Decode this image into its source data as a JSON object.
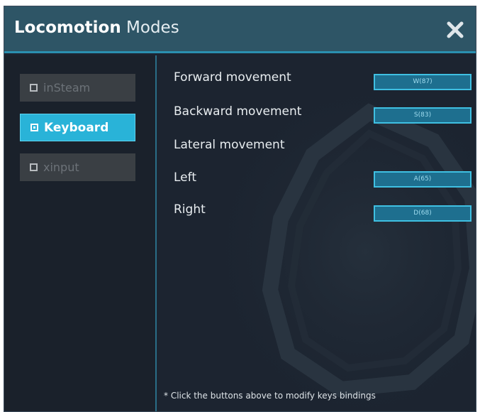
{
  "window": {
    "title_bold": "Locomotion",
    "title_light": "Modes",
    "close_icon": "close-icon"
  },
  "sidebar": {
    "modes": [
      {
        "label": "inSteam",
        "active": false
      },
      {
        "label": "Keyboard",
        "active": true
      },
      {
        "label": "xinput",
        "active": false
      }
    ]
  },
  "bindings": {
    "forward": {
      "label": "Forward movement",
      "key": "W(87)"
    },
    "backward": {
      "label": "Backward movement",
      "key": "S(83)"
    },
    "lateral": {
      "label": "Lateral movement"
    },
    "left": {
      "label": "Left",
      "key": "A(65)"
    },
    "right": {
      "label": "Right",
      "key": "D(68)"
    }
  },
  "footnote": "* Click the buttons above to modify keys bindings",
  "colors": {
    "accent": "#29b3d8",
    "titlebar": "#2e5566",
    "panel": "#1c2430"
  }
}
